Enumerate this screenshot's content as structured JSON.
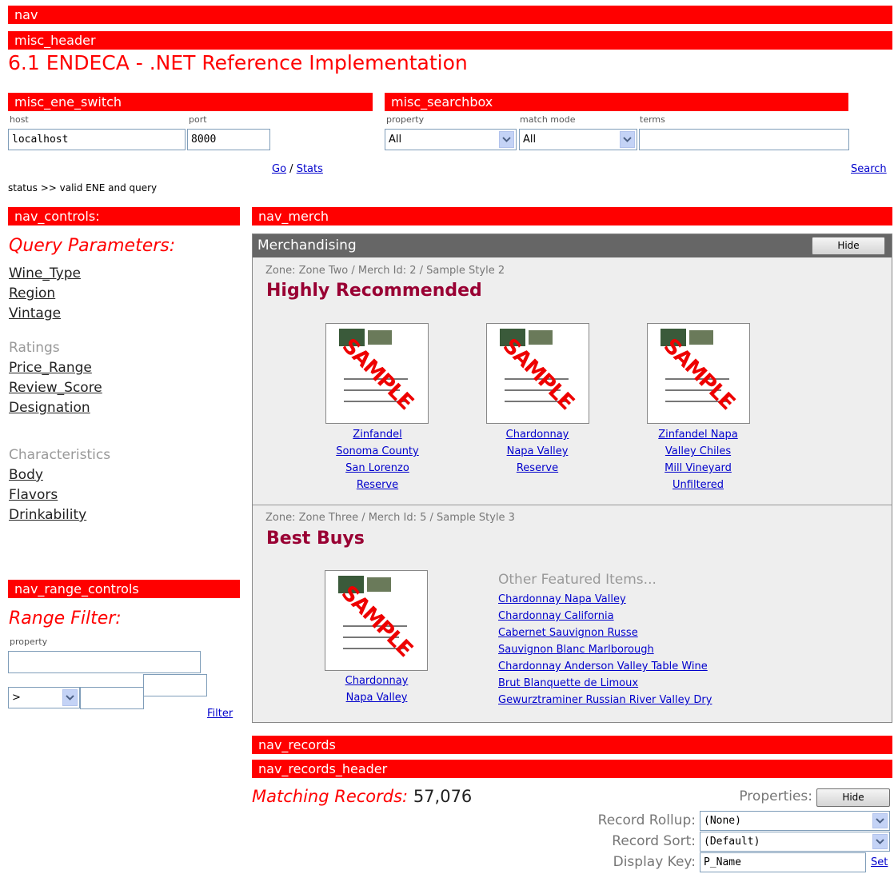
{
  "bars": {
    "nav": "nav",
    "misc_header": "misc_header",
    "misc_ene_switch": "misc_ene_switch",
    "misc_searchbox": "misc_searchbox",
    "nav_controls": "nav_controls:",
    "nav_merch": "nav_merch",
    "nav_range_controls": "nav_range_controls",
    "nav_records": "nav_records",
    "nav_records_header": "nav_records_header"
  },
  "page_title": "6.1 ENDECA - .NET Reference Implementation",
  "ene_switch": {
    "host_label": "host",
    "port_label": "port",
    "host_value": "localhost",
    "port_value": "8000",
    "go_label": "Go",
    "sep": "/",
    "stats_label": "Stats"
  },
  "searchbox": {
    "property_label": "property",
    "match_mode_label": "match mode",
    "terms_label": "terms",
    "property_value": "All",
    "match_mode_value": "All",
    "terms_value": "",
    "search_label": "Search"
  },
  "status": "status >> valid ENE and query",
  "nav_controls": {
    "heading": "Query Parameters:",
    "links_a": [
      "Wine_Type",
      "Region",
      "Vintage"
    ],
    "group_ratings": "Ratings",
    "links_b": [
      "Price_Range",
      "Review_Score",
      "Designation"
    ],
    "group_characteristics": "Characteristics",
    "links_c": [
      "Body",
      "Flavors",
      "Drinkability"
    ]
  },
  "range_controls": {
    "heading": "Range Filter:",
    "property_label": "property",
    "operator_value": ">",
    "filter_label": "Filter"
  },
  "merch": {
    "header": "Merchandising",
    "hide_label": "Hide",
    "zone1": {
      "meta": "Zone: Zone Two / Merch Id: 2 / Sample Style 2",
      "title": "Highly Recommended",
      "items": [
        [
          "Zinfandel",
          "Sonoma County",
          "San Lorenzo",
          "Reserve"
        ],
        [
          "Chardonnay",
          "Napa Valley",
          "Reserve"
        ],
        [
          "Zinfandel Napa",
          "Valley Chiles",
          "Mill Vineyard",
          "Unfiltered"
        ]
      ]
    },
    "zone2": {
      "meta": "Zone: Zone Three / Merch Id: 5 / Sample Style 3",
      "title": "Best Buys",
      "item": [
        "Chardonnay",
        "Napa Valley"
      ],
      "featured_heading": "Other Featured Items...",
      "featured": [
        "Chardonnay Napa Valley",
        "Chardonnay California",
        "Cabernet Sauvignon Russe",
        "Sauvignon Blanc Marlborough",
        "Chardonnay Anderson Valley Table Wine",
        "Brut Blanquette de Limoux",
        "Gewurztraminer Russian River Valley Dry"
      ]
    },
    "stamp_text": "SAMPLE"
  },
  "records": {
    "matching_label": "Matching Records:",
    "matching_count": "57,076",
    "properties_label": "Properties:",
    "hide_label": "Hide",
    "rollup_label": "Record Rollup:",
    "rollup_value": "(None)",
    "sort_label": "Record Sort:",
    "sort_value": "(Default)",
    "display_key_label": "Display Key:",
    "display_key_value": "P_Name",
    "set_label": "Set"
  },
  "colors": {
    "accent": "#ff0000",
    "link": "#0000cc",
    "merch_header": "#666666",
    "merch_title": "#990033"
  }
}
